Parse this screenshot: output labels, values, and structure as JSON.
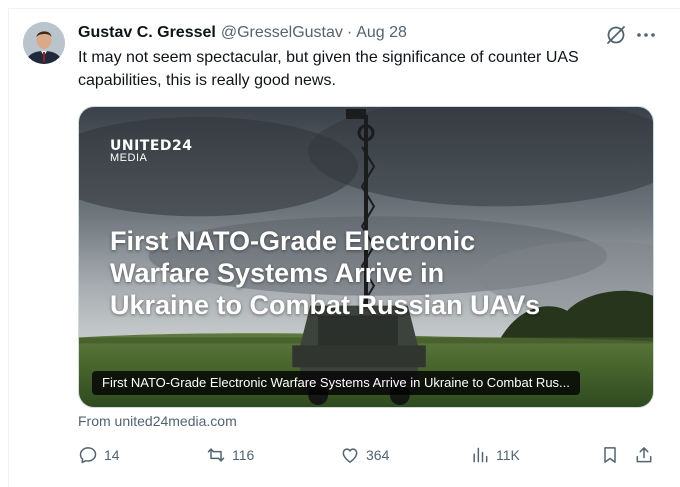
{
  "author": {
    "name": "Gustav C. Gressel",
    "handle": "@GresselGustav",
    "separator": "·",
    "date": "Aug 28"
  },
  "tweet": {
    "text": "It may not seem spectacular, but given the significance of counter UAS capabilities, this is really good news."
  },
  "card": {
    "brand_line1": "UNITED24",
    "brand_line2": "MEDIA",
    "headline": "First NATO-Grade Electronic Warfare Systems Arrive in Ukraine to Combat Russian UAVs",
    "caption": "First NATO-Grade Electronic Warfare Systems Arrive in Ukraine to Combat Rus...",
    "source": "From united24media.com"
  },
  "actions": {
    "replies": "14",
    "reposts": "116",
    "likes": "364",
    "views": "11K"
  },
  "icons": {
    "header": [
      "grok-icon",
      "more-icon"
    ],
    "actions": [
      "reply-icon",
      "repost-icon",
      "like-icon",
      "views-icon",
      "bookmark-icon",
      "share-icon"
    ]
  },
  "colors": {
    "text": "#0f1419",
    "secondary": "#536471",
    "border": "#cfd9de"
  }
}
